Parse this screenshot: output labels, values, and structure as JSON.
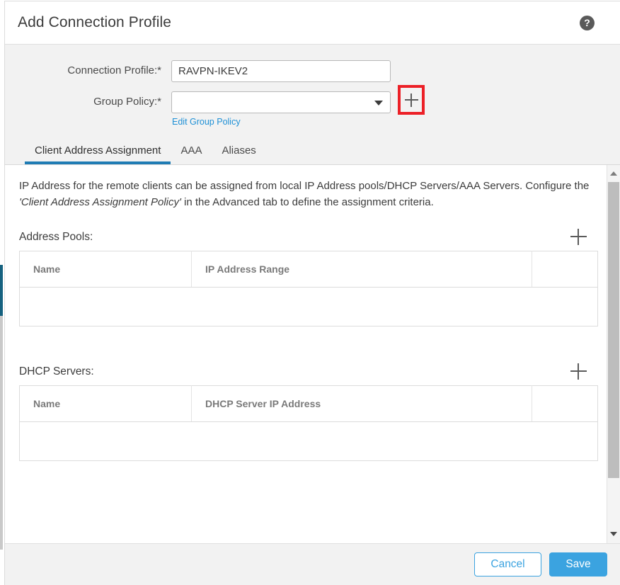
{
  "dialog": {
    "title": "Add Connection Profile",
    "help_icon_glyph": "?"
  },
  "form": {
    "connection_profile": {
      "label": "Connection Profile:*",
      "value": "RAVPN-IKEV2",
      "placeholder": ""
    },
    "group_policy": {
      "label": "Group Policy:*",
      "value": "",
      "placeholder": "",
      "edit_link": "Edit Group Policy",
      "add_button_glyph": "+",
      "highlight_color": "#ec2027"
    }
  },
  "tabs": [
    {
      "label": "Client Address Assignment",
      "active": true
    },
    {
      "label": "AAA",
      "active": false
    },
    {
      "label": "Aliases",
      "active": false
    }
  ],
  "content": {
    "intro_part1": "IP Address for the remote clients can be assigned from local IP Address pools/DHCP Servers/AAA Servers. Configure the ",
    "intro_emphasis": "'Client Address Assignment Policy'",
    "intro_part2": " in the Advanced tab to define the assignment criteria.",
    "address_pools": {
      "title": "Address Pools:",
      "add_glyph": "+",
      "columns": [
        "Name",
        "IP Address Range",
        ""
      ],
      "rows": []
    },
    "dhcp_servers": {
      "title": "DHCP Servers:",
      "add_glyph": "+",
      "columns": [
        "Name",
        "DHCP Server IP Address",
        ""
      ],
      "rows": []
    }
  },
  "scrollbar": {
    "up_arrow": "▲",
    "down_arrow": "▼"
  },
  "footer": {
    "cancel_label": "Cancel",
    "save_label": "Save",
    "accent_color": "#3ba3e0"
  }
}
